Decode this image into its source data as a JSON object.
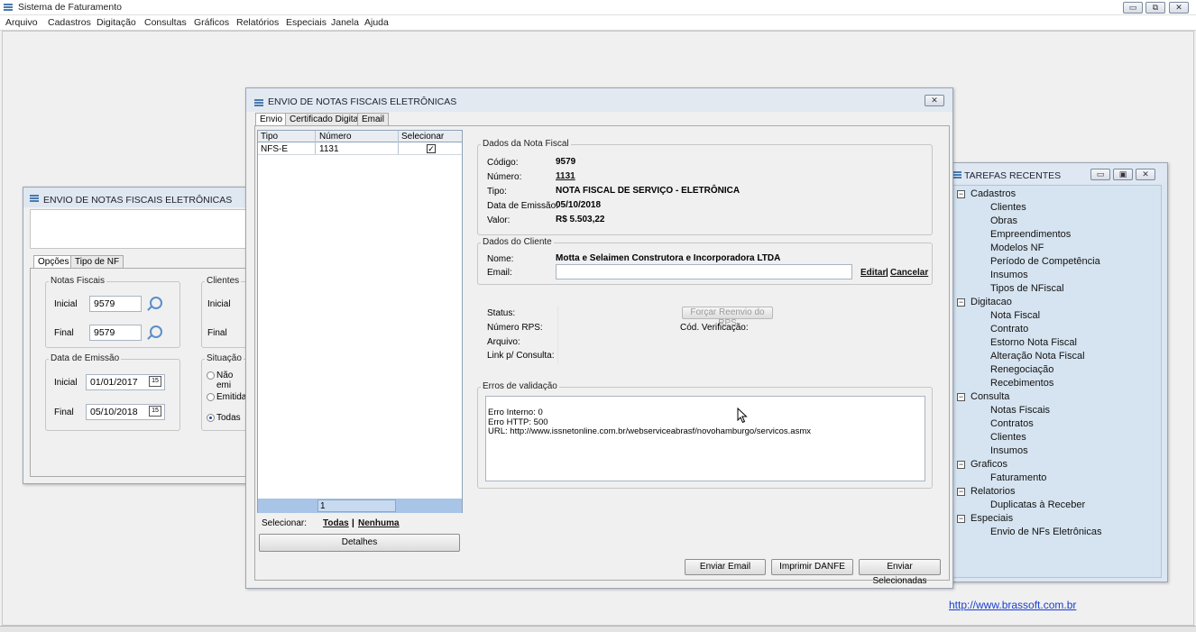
{
  "app": {
    "title": "Sistema de Faturamento",
    "menu": [
      "Arquivo",
      "Cadastros",
      "Digitação",
      "Consultas",
      "Gráficos",
      "Relatórios",
      "Especiais",
      "Janela",
      "Ajuda"
    ],
    "website": "http://www.brassoft.com.br"
  },
  "bg_window": {
    "title": "ENVIO DE NOTAS FISCAIS ELETRÔNICAS",
    "tabs": [
      "Opções",
      "Tipo de NF"
    ],
    "notas_fiscais": {
      "label": "Notas Fiscais",
      "inicial_label": "Inicial",
      "inicial": "9579",
      "final_label": "Final",
      "final": "9579"
    },
    "data_emissao": {
      "label": "Data de Emissão",
      "inicial_label": "Inicial",
      "inicial": "01/01/2017",
      "final_label": "Final",
      "final": "05/10/2018"
    },
    "clientes": {
      "label": "Clientes",
      "inicial_label": "Inicial",
      "final_label": "Final"
    },
    "situacao": {
      "label": "Situação",
      "options": [
        "Não emi",
        "Emitidas",
        "Todas"
      ],
      "selected": "Todas"
    }
  },
  "main_window": {
    "title": "ENVIO DE NOTAS FISCAIS ELETRÔNICAS",
    "tabs": [
      "Envio",
      "Certificado Digital",
      "Email"
    ],
    "grid": {
      "headers": [
        "Tipo",
        "Número",
        "Selecionar"
      ],
      "rows": [
        {
          "tipo": "NFS-E",
          "numero": "1131",
          "selecionar": true
        }
      ],
      "footer_count": "1"
    },
    "selecionar": {
      "label": "Selecionar:",
      "todas": "Todas",
      "sep": "|",
      "nenhuma": "Nenhuma"
    },
    "detalhes_button": "Detalhes",
    "dados_nf": {
      "label": "Dados da Nota Fiscal",
      "codigo_label": "Código:",
      "codigo": "9579",
      "numero_label": "Número:",
      "numero": "1131",
      "tipo_label": "Tipo:",
      "tipo": "NOTA FISCAL DE SERVIÇO - ELETRÔNICA",
      "data_label": "Data de Emissão:",
      "data": "05/10/2018",
      "valor_label": "Valor:",
      "valor": "R$ 5.503,22"
    },
    "dados_cliente": {
      "label": "Dados do Cliente",
      "nome_label": "Nome:",
      "nome": "Motta e Selaimen Construtora e Incorporadora LTDA",
      "email_label": "Email:",
      "email": "",
      "editar": "Editar",
      "sep": "|",
      "cancelar": "Cancelar"
    },
    "status": {
      "status_label": "Status:",
      "rps_label": "Número RPS:",
      "arquivo_label": "Arquivo:",
      "link_label": "Link p/ Consulta:",
      "reenvio_button": "Forçar Reenvio do RPS",
      "cod_verificacao_label": "Cód. Verificação:"
    },
    "erros": {
      "label": "Erros de validação",
      "lines": [
        "Erro Interno: 0",
        "Erro HTTP: 500",
        "URL: http://www.issnetonline.com.br/webserviceabrasf/novohamburgo/servicos.asmx"
      ]
    },
    "buttons": {
      "enviar_email": "Enviar Email",
      "imprimir": "Imprimir DANFE",
      "enviar_sel": "Enviar Selecionadas"
    }
  },
  "tarefas": {
    "title": "TAREFAS RECENTES",
    "groups": [
      {
        "name": "Cadastros",
        "items": [
          "Clientes",
          "Obras",
          "Empreendimentos",
          "Modelos NF",
          "Período de Competência",
          "Insumos",
          "Tipos de NFiscal"
        ]
      },
      {
        "name": "Digitacao",
        "items": [
          "Nota Fiscal",
          "Contrato",
          "Estorno Nota Fiscal",
          "Alteração Nota Fiscal",
          "Renegociação",
          "Recebimentos"
        ]
      },
      {
        "name": "Consulta",
        "items": [
          "Notas Fiscais",
          "Contratos",
          "Clientes",
          "Insumos"
        ]
      },
      {
        "name": "Graficos",
        "items": [
          "Faturamento"
        ]
      },
      {
        "name": "Relatorios",
        "items": [
          "Duplicatas à Receber"
        ]
      },
      {
        "name": "Especiais",
        "items": [
          "Envio de NFs Eletrônicas"
        ]
      }
    ]
  }
}
